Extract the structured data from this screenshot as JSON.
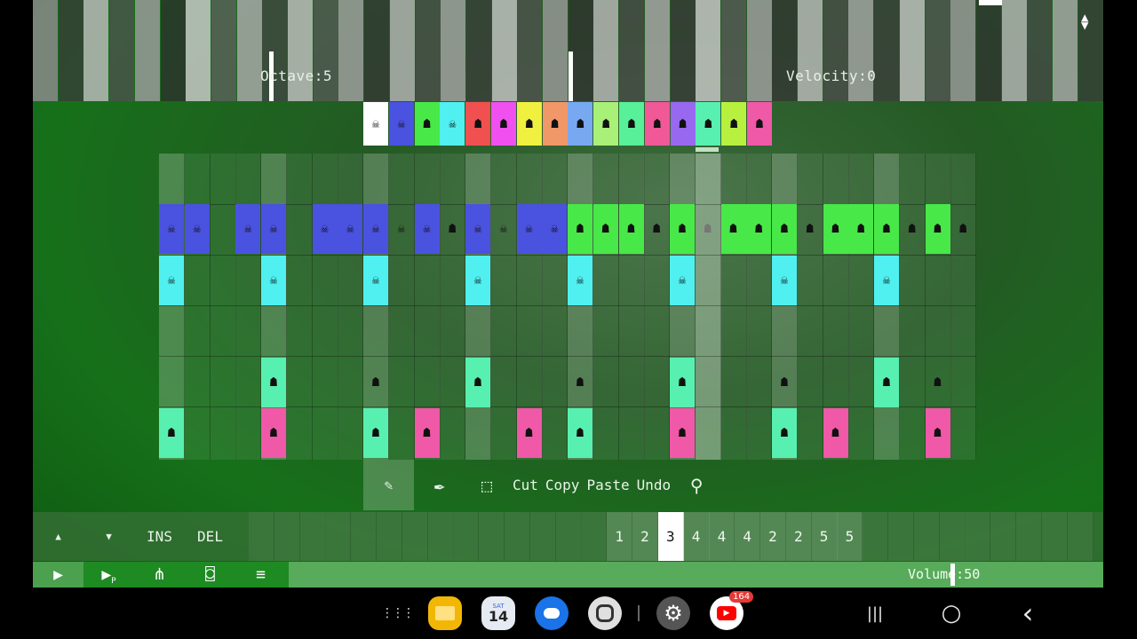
{
  "header": {
    "octave_label": "Octave:5",
    "velocity_label": "Velocity:0"
  },
  "palette": {
    "colors": [
      "#ffffff",
      "#4a52e0",
      "#48e848",
      "#50f0f0",
      "#f05050",
      "#f050f0",
      "#f0f040",
      "#f09868",
      "#78a8f0",
      "#a8f078",
      "#58f098",
      "#f05898",
      "#9868f0",
      "#58f0b0",
      "#b8f040",
      "#f058a8"
    ],
    "glyphs": [
      "☠",
      "☠",
      "☗",
      "☠",
      "☗",
      "☗",
      "☗",
      "☗",
      "☗",
      "☗",
      "☗",
      "☗",
      "☗",
      "☗",
      "☗",
      "☗"
    ]
  },
  "grid": {
    "rows": [
      {
        "cells": [
          1,
          1,
          0,
          1,
          1,
          0,
          1,
          1,
          1,
          "d",
          1,
          "g",
          1,
          "d",
          1,
          1,
          2,
          2,
          2,
          "k",
          2,
          "x",
          2,
          2,
          2,
          "k",
          2,
          2,
          2,
          "k",
          2,
          "k"
        ]
      },
      {
        "cells": [
          3,
          0,
          0,
          0,
          3,
          0,
          0,
          0,
          3,
          0,
          0,
          0,
          3,
          0,
          0,
          0,
          3,
          0,
          0,
          0,
          3,
          0,
          0,
          0,
          3,
          0,
          0,
          0,
          3,
          0,
          0,
          0
        ]
      },
      {
        "cells": [
          0,
          0,
          0,
          0,
          0,
          0,
          0,
          0,
          0,
          0,
          0,
          0,
          0,
          0,
          0,
          0,
          0,
          0,
          0,
          0,
          0,
          0,
          0,
          0,
          0,
          0,
          0,
          0,
          0,
          0,
          0,
          0
        ]
      },
      {
        "cells": [
          0,
          0,
          0,
          0,
          13,
          0,
          0,
          0,
          "k",
          0,
          0,
          0,
          13,
          0,
          0,
          0,
          "k",
          0,
          0,
          0,
          13,
          0,
          0,
          0,
          "k",
          0,
          0,
          0,
          13,
          0,
          "k",
          0
        ]
      },
      {
        "cells": [
          13,
          0,
          0,
          0,
          15,
          0,
          0,
          0,
          13,
          0,
          15,
          0,
          0,
          0,
          15,
          0,
          13,
          0,
          0,
          0,
          15,
          0,
          0,
          0,
          13,
          0,
          15,
          0,
          0,
          0,
          15,
          0
        ]
      }
    ]
  },
  "toolbar": {
    "pencil_icon": "✎",
    "brush_icon": "✒",
    "select_icon": "⬚",
    "cut": "Cut",
    "copy": "Copy",
    "paste": "Paste",
    "undo": "Undo",
    "zoom_icon": "⚲"
  },
  "sequence": {
    "up": "▲",
    "down": "▼",
    "ins": "INS",
    "del": "DEL",
    "patterns": [
      "1",
      "2",
      "3",
      "4",
      "4",
      "4",
      "2",
      "2",
      "5",
      "5"
    ],
    "current_index": 2
  },
  "transport": {
    "play": "▶",
    "play_pattern": "▶",
    "play_pattern_sub": "P",
    "wave": "⋔",
    "tv": "⌼",
    "menu": "≡",
    "volume_label": "Volume:50"
  },
  "android_nav": {
    "apps": "⋮⋮⋮",
    "calendar_day": "14",
    "calendar_dow": "SAT",
    "youtube_badge": "164",
    "recents": "|||",
    "home": "○",
    "back": "‹"
  }
}
